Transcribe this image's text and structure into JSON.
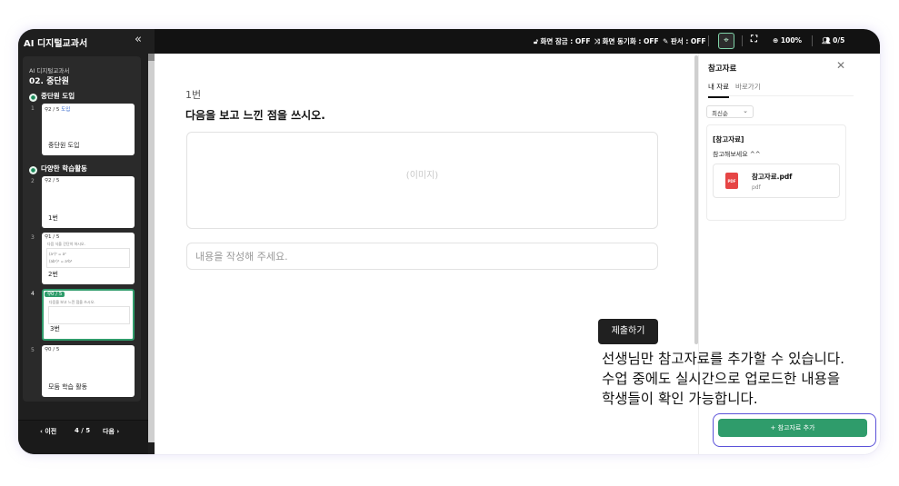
{
  "app": {
    "title": "AI 디지털교과서",
    "collapse_icon": "double-chevron-left-icon"
  },
  "toolbar": {
    "screen_lock": "화면 잠금 : OFF",
    "screen_sync": "화면 동기화 : OFF",
    "pen": "판서 : OFF",
    "zoom": "100%",
    "students": "0/5"
  },
  "sidebar": {
    "subtitle": "AI 디지털교과서",
    "unit": "02. 중단원",
    "sections": [
      {
        "label": "중단원 도입"
      },
      {
        "label": "다양한 학습활동"
      }
    ],
    "cards": [
      {
        "num": "1",
        "count": "2 / 5",
        "extra": "도입",
        "title": "중단원 도입"
      },
      {
        "num": "2",
        "count": "2 / 5",
        "title": "1번"
      },
      {
        "num": "3",
        "count": "1 / 5",
        "title": "2번",
        "q": "다음 식을 간단히 하시오.",
        "e1": "(a²)³ = a⁶",
        "e2": "(ab²)² = a²b⁴"
      },
      {
        "num": "4",
        "count": "0 / 5",
        "title": "3번",
        "q": "다음을 보고 느낀 점을 쓰시오."
      },
      {
        "num": "5",
        "count": "0 / 5",
        "title": "모둠 학습 활동"
      }
    ],
    "footer": {
      "prev": "이전",
      "page": "4 / 5",
      "next": "다음"
    }
  },
  "main": {
    "question_number": "1번",
    "question_title": "다음을 보고 느낀 점을 쓰시오.",
    "image_placeholder": "(이미지)",
    "answer_placeholder": "내용을 작성해 주세요.",
    "submit_label": "제출하기"
  },
  "panel": {
    "title": "참고자료",
    "tabs": [
      "내 자료",
      "바로가기"
    ],
    "sort_label": "최신순",
    "card_title": "[참고자료]",
    "card_message": "참고해보세요 ^^",
    "file_name": "참고자료.pdf",
    "file_type": "pdf",
    "pdf_badge": "PDF",
    "add_label": "참고자료 추가"
  },
  "callout": {
    "line1": "선생님만 참고자료를 추가할 수 있습니다.",
    "line2": "수업 중에도 실시간으로 업로드한 내용을",
    "line3": "학생들이 확인 가능합니다."
  },
  "colors": {
    "accent_green": "#2f9c6b",
    "highlight_outline": "#5b52d9",
    "dark_bar": "#121212"
  }
}
